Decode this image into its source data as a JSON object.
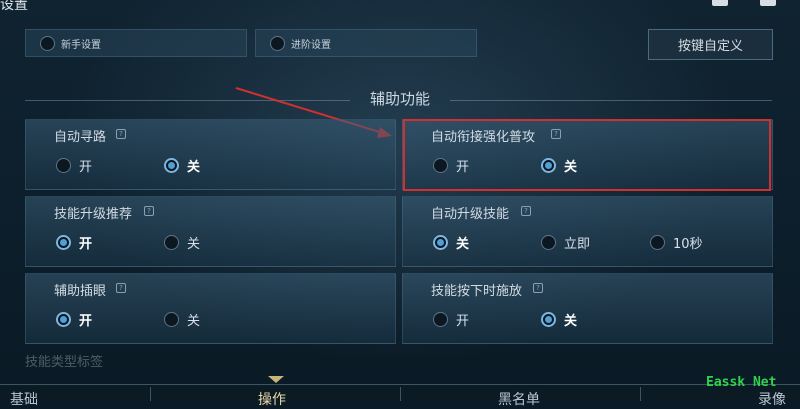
{
  "header": {
    "title": "设置"
  },
  "presets": [
    {
      "label": "新手设置"
    },
    {
      "label": "进阶设置"
    }
  ],
  "keybind_button": "按键自定义",
  "section_title": "辅助功能",
  "panels": [
    {
      "title": "自动寻路",
      "options": [
        "开",
        "关"
      ],
      "selected": "关"
    },
    {
      "title": "自动衔接强化普攻",
      "options": [
        "开",
        "关"
      ],
      "selected": "关"
    },
    {
      "title": "技能升级推荐",
      "options": [
        "开",
        "关"
      ],
      "selected": "开"
    },
    {
      "title": "自动升级技能",
      "options": [
        "关",
        "立即",
        "10秒"
      ],
      "selected": "关"
    },
    {
      "title": "辅助插眼",
      "options": [
        "开",
        "关"
      ],
      "selected": "开"
    },
    {
      "title": "技能按下时施放",
      "options": [
        "开",
        "关"
      ],
      "selected": "关"
    }
  ],
  "faded_item": "技能类型标签",
  "tabs": [
    "基础",
    "操作",
    "黑名单",
    "录像"
  ],
  "active_tab": "操作",
  "watermark": "Eassk Net",
  "colors": {
    "highlight": "#d03030",
    "accent": "#4f9fd8",
    "arrow": "#d03030"
  }
}
